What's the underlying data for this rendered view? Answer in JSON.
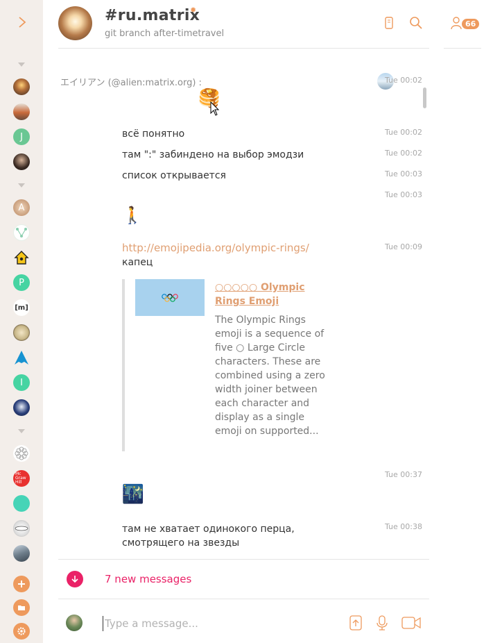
{
  "room": {
    "name": "#ru.matrix",
    "topic": "git branch after-timetravel",
    "member_count": "66"
  },
  "sidebar": {
    "rooms": [
      {
        "icon": "room-avatar-candle"
      },
      {
        "icon": "room-avatar-landscape"
      },
      {
        "letter": "J",
        "color": "#6ac793"
      },
      {
        "icon": "room-avatar-portrait"
      },
      {
        "letter": "A",
        "color": "#c8a07a"
      },
      {
        "icon": "room-avatar-graph"
      },
      {
        "icon": "room-avatar-home"
      },
      {
        "letter": "P",
        "color": "#46d4a2"
      },
      {
        "letter": "[m]",
        "color": "#ffffff"
      },
      {
        "icon": "room-avatar-clock"
      },
      {
        "icon": "room-avatar-arch"
      },
      {
        "letter": "I",
        "color": "#46d4a2"
      },
      {
        "icon": "room-avatar-crest"
      },
      {
        "icon": "room-avatar-flower"
      },
      {
        "letter": "Mc Graw Hill",
        "color": "#e8312f"
      },
      {
        "letter": "",
        "color": "#46d4b7"
      },
      {
        "icon": "room-avatar-logo"
      },
      {
        "icon": "room-avatar-building"
      }
    ]
  },
  "timeline": {
    "sender": "エイリアン (@alien:matrix.org) :",
    "messages": [
      {
        "kind": "emoji",
        "emoji": "🥞",
        "time": "Tue 00:02"
      },
      {
        "kind": "text",
        "text": "всё понятно",
        "time": "Tue 00:02"
      },
      {
        "kind": "text",
        "text": "там \":\" забиндено на выбор эмодзи",
        "time": "Tue 00:02"
      },
      {
        "kind": "text",
        "text": "список открывается",
        "time": "Tue 00:03"
      },
      {
        "kind": "emoji",
        "emoji": "🚶",
        "time": "Tue 00:03"
      },
      {
        "kind": "link",
        "link": "http://emojipedia.org/olympic-rings/",
        "text": "капец",
        "time": "Tue 00:09"
      },
      {
        "kind": "emoji",
        "emoji": "🌃",
        "time": "Tue 00:37"
      },
      {
        "kind": "text",
        "text": "там не хватает одинокого перца, смотрящего на звезды",
        "time": "Tue 00:38"
      }
    ],
    "preview": {
      "title": "○○○○○ Olympic Rings Emoji",
      "description": "The Olympic Rings emoji is a sequence of five ○ Large Circle characters. These are combined using a zero width joiner between each character and display as a single emoji on supported..."
    }
  },
  "new_messages": {
    "label": "7 new messages"
  },
  "composer": {
    "placeholder": "Type a message..."
  },
  "colors": {
    "accent": "#ee9a5d",
    "link": "#e09f72",
    "alert": "#ea2267",
    "sidebar_bg": "#f3eeea"
  }
}
